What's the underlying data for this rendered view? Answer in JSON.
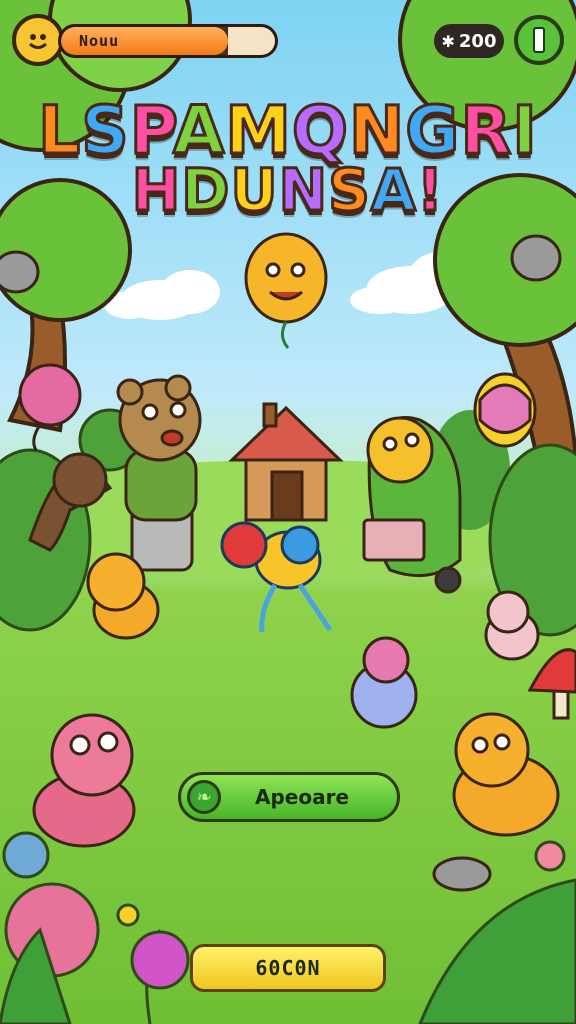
{
  "hud": {
    "level_label": "Nouu",
    "progress_fraction": 0.78,
    "coin_icon": "puzzle-icon",
    "coin_count": "200",
    "pause_icon": "pause-icon"
  },
  "title": {
    "line1": [
      "L",
      "S",
      "P",
      "A",
      "M",
      "Q",
      "N",
      "G",
      "R",
      "I"
    ],
    "line2": [
      "H",
      "D",
      "U",
      "N",
      "S",
      "A",
      "!"
    ],
    "colors": [
      "#ff8a1f",
      "#3fa9f5",
      "#ff4fa3",
      "#7ed13f",
      "#ffd21a",
      "#b66cff"
    ]
  },
  "buttons": {
    "primary_label": "Apeoare",
    "primary_icon": "leaf-icon",
    "secondary_label": "60C0N"
  },
  "colors": {
    "sky": "#7ed3f3",
    "grass": "#6fbf35",
    "primary_button": "#47b52a",
    "secondary_button": "#f0c51c"
  }
}
